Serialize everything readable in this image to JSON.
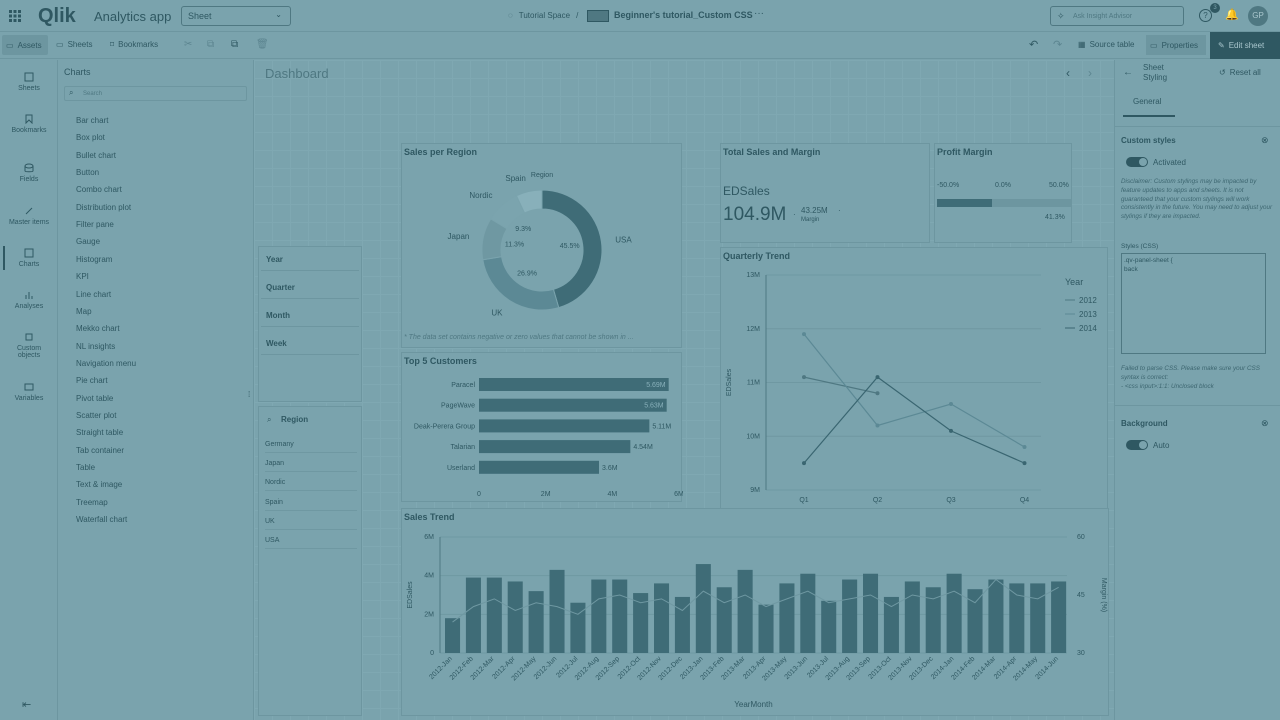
{
  "header": {
    "app_name": "Analytics app",
    "sheet_select": "Sheet",
    "space": "Tutorial Space",
    "separator": "/",
    "title": "Beginner's tutorial_Custom CSS",
    "search_placeholder": "Ask Insight Advisor",
    "notif_count": "3",
    "avatar": "GP"
  },
  "toolbar": {
    "assets": "Assets",
    "sheets": "Sheets",
    "bookmarks": "Bookmarks",
    "source_table": "Source table",
    "properties": "Properties",
    "edit_sheet": "Edit sheet"
  },
  "nav": [
    "Sheets",
    "Bookmarks",
    "Fields",
    "Master items",
    "Charts",
    "Analyses",
    "Custom objects",
    "Variables"
  ],
  "charts_panel": {
    "title": "Charts",
    "search_placeholder": "Search",
    "items": [
      "Bar chart",
      "Box plot",
      "Bullet chart",
      "Button",
      "Combo chart",
      "Distribution plot",
      "Filter pane",
      "Gauge",
      "Histogram",
      "KPI",
      "Line chart",
      "Map",
      "Mekko chart",
      "NL insights",
      "Navigation menu",
      "Pie chart",
      "Pivot table",
      "Scatter plot",
      "Straight table",
      "Tab container",
      "Table",
      "Text & image",
      "Treemap",
      "Waterfall chart"
    ]
  },
  "sheet": {
    "title": "Dashboard",
    "filters": [
      "Year",
      "Quarter",
      "Month",
      "Week"
    ],
    "region_title": "Region",
    "regions": [
      "Germany",
      "Japan",
      "Nordic",
      "Spain",
      "UK",
      "USA"
    ]
  },
  "sales_per_region": {
    "title": "Sales per Region",
    "legend_title": "Region",
    "footnote": "* The data set contains negative or zero values that cannot be shown in ...",
    "slices": [
      {
        "name": "USA",
        "value": 45.5,
        "label": "45.5%"
      },
      {
        "name": "UK",
        "value": 26.9,
        "label": "26.9%"
      },
      {
        "name": "Japan",
        "value": 11.3,
        "label": "11.3%"
      },
      {
        "name": "Nordic",
        "value": 9.3,
        "label": "9.3%"
      },
      {
        "name": "Spain",
        "value": 7.0,
        "label": ""
      }
    ]
  },
  "total_sales": {
    "title": "Total Sales and Margin",
    "measure": "EDSales",
    "value": "104.9M",
    "margin_value": "43.25M",
    "margin_label": "Margin"
  },
  "profit_margin": {
    "title": "Profit Margin",
    "ticks": [
      "-50.0%",
      "0.0%",
      "50.0%"
    ],
    "value": "41.3%",
    "fraction": 0.413
  },
  "quarterly_trend": {
    "title": "Quarterly Trend",
    "ylabel": "EDSales",
    "legend_title": "Year",
    "yticks": [
      "13M",
      "12M",
      "11M",
      "10M",
      "9M"
    ],
    "xticks": [
      "Q1",
      "Q2",
      "Q3",
      "Q4"
    ]
  },
  "top5": {
    "title": "Top 5 Customers",
    "xticks": [
      "0",
      "2M",
      "4M",
      "6M"
    ]
  },
  "sales_trend": {
    "title": "Sales Trend",
    "ylabel": "EDSales",
    "ylabel_right": "Margin (%)",
    "xlabel": "YearMonth",
    "yticks": [
      "6M",
      "4M",
      "2M",
      "0"
    ],
    "yticks_right": [
      "60",
      "45",
      "30"
    ]
  },
  "right_panel": {
    "title_line1": "Sheet",
    "title_line2": "Styling",
    "reset": "Reset all",
    "tab_general": "General",
    "custom_styles": "Custom styles",
    "activated": "Activated",
    "disclaimer": "Disclaimer: Custom stylings may be impacted by feature updates to apps and sheets. It is not guaranteed that your custom stylings will work consistently in the future. You may need to adjust your stylings if they are impacted.",
    "styles_label": "Styles (CSS)",
    "css_line1": ".qv-panel-sheet {",
    "css_line2": "back",
    "error": "Failed to parse CSS. Please make sure your CSS syntax is correct:",
    "error_detail": "- <css input>:1:1: Unclosed block",
    "background": "Background",
    "auto": "Auto"
  },
  "chart_data": [
    {
      "type": "line",
      "title": "Quarterly Trend",
      "xlabel": "",
      "ylabel": "EDSales",
      "categories": [
        "Q1",
        "Q2",
        "Q3",
        "Q4"
      ],
      "ylim": [
        9,
        13
      ],
      "series": [
        {
          "name": "2012",
          "values": [
            11.1,
            10.8,
            null,
            null
          ]
        },
        {
          "name": "2013",
          "values": [
            11.9,
            10.2,
            10.6,
            9.8
          ]
        },
        {
          "name": "2014",
          "values": [
            9.5,
            11.1,
            10.1,
            9.5
          ]
        }
      ]
    },
    {
      "type": "bar",
      "title": "Top 5 Customers",
      "categories": [
        "Paracel",
        "PageWave",
        "Deak-Perera Group",
        "Talarian",
        "Userland"
      ],
      "values": [
        5.69,
        5.63,
        5.11,
        4.54,
        3.6
      ],
      "value_labels": [
        "5.69M",
        "5.63M",
        "5.11M",
        "4.54M",
        "3.6M"
      ],
      "xlim": [
        0,
        6
      ]
    },
    {
      "type": "bar",
      "title": "Sales Trend",
      "xlabel": "YearMonth",
      "ylabel": "EDSales",
      "categories": [
        "2012-Jan",
        "2012-Feb",
        "2012-Mar",
        "2012-Apr",
        "2012-May",
        "2012-Jun",
        "2012-Jul",
        "2012-Aug",
        "2012-Sep",
        "2012-Oct",
        "2012-Nov",
        "2012-Dec",
        "2013-Jan",
        "2013-Feb",
        "2013-Mar",
        "2013-Apr",
        "2013-May",
        "2013-Jun",
        "2013-Jul",
        "2013-Aug",
        "2013-Sep",
        "2013-Oct",
        "2013-Nov",
        "2013-Dec",
        "2014-Jan",
        "2014-Feb",
        "2014-Mar",
        "2014-Apr",
        "2014-May",
        "2014-Jun"
      ],
      "values": [
        1.8,
        3.9,
        3.9,
        3.7,
        3.2,
        4.3,
        2.6,
        3.8,
        3.8,
        3.1,
        3.6,
        2.9,
        4.6,
        3.4,
        4.3,
        2.5,
        3.6,
        4.1,
        2.7,
        3.8,
        4.1,
        2.9,
        3.7,
        3.4,
        4.1,
        3.3,
        3.8,
        3.6,
        3.6,
        3.7
      ],
      "ylim": [
        0,
        6
      ],
      "margin_series": {
        "name": "Margin (%)",
        "values": [
          38,
          42,
          44,
          41,
          43,
          42,
          40,
          44,
          45,
          43,
          44,
          41,
          46,
          43,
          45,
          42,
          44,
          46,
          43,
          44,
          45,
          42,
          45,
          44,
          46,
          43,
          49,
          45,
          44,
          47
        ],
        "ylim": [
          30,
          60
        ]
      }
    }
  ]
}
